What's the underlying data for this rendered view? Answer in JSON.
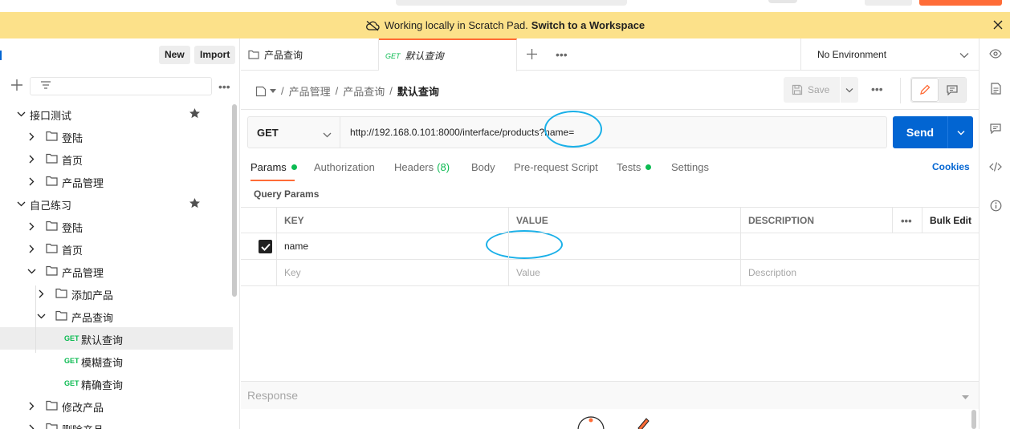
{
  "banner": {
    "text": "Working locally in Scratch Pad.",
    "link": "Switch to a Workspace"
  },
  "sidebar": {
    "new_label": "New",
    "import_label": "Import",
    "tree": [
      {
        "label": "接口测试",
        "type": "collection",
        "expanded": true,
        "starred": true
      },
      {
        "label": "登陆",
        "type": "folder",
        "expanded": false
      },
      {
        "label": "首页",
        "type": "folder",
        "expanded": false
      },
      {
        "label": "产品管理",
        "type": "folder",
        "expanded": false
      },
      {
        "label": "自己练习",
        "type": "collection",
        "expanded": true,
        "starred": true
      },
      {
        "label": "登陆",
        "type": "folder",
        "expanded": false
      },
      {
        "label": "首页",
        "type": "folder",
        "expanded": false
      },
      {
        "label": "产品管理",
        "type": "folder",
        "expanded": true
      },
      {
        "label": "添加产品",
        "type": "folder",
        "expanded": false
      },
      {
        "label": "产品查询",
        "type": "folder",
        "expanded": true
      },
      {
        "label": "默认查询",
        "type": "request",
        "method": "GET",
        "selected": true
      },
      {
        "label": "模糊查询",
        "type": "request",
        "method": "GET"
      },
      {
        "label": "精确查询",
        "type": "request",
        "method": "GET"
      },
      {
        "label": "修改产品",
        "type": "folder",
        "expanded": false
      },
      {
        "label": "删除产品",
        "type": "folder",
        "expanded": false
      }
    ]
  },
  "tabs": [
    {
      "label": "产品查询",
      "type": "folder"
    },
    {
      "label": "默认查询",
      "method": "GET",
      "active": true
    }
  ],
  "environment": "No Environment",
  "breadcrumb": {
    "items": [
      "产品管理",
      "产品查询"
    ],
    "current": "默认查询"
  },
  "toolbar": {
    "save_label": "Save"
  },
  "request": {
    "method": "GET",
    "url": "http://192.168.0.101:8000/interface/products?name=",
    "send_label": "Send"
  },
  "subtabs": [
    {
      "label": "Params",
      "active": true,
      "dot": true
    },
    {
      "label": "Authorization"
    },
    {
      "label": "Headers",
      "count": "(8)"
    },
    {
      "label": "Body"
    },
    {
      "label": "Pre-request Script"
    },
    {
      "label": "Tests",
      "dot": true
    },
    {
      "label": "Settings"
    }
  ],
  "cookies_label": "Cookies",
  "query_params": {
    "title": "Query Params",
    "columns": [
      "KEY",
      "VALUE",
      "DESCRIPTION"
    ],
    "bulk_edit": "Bulk Edit",
    "rows": [
      {
        "checked": true,
        "key": "name",
        "value": "",
        "description": ""
      }
    ],
    "placeholders": {
      "key": "Key",
      "value": "Value",
      "description": "Description"
    }
  },
  "response": {
    "title": "Response"
  },
  "colors": {
    "accent": "#ff6c37",
    "primary": "#0265d2",
    "get_method": "#0cbb52",
    "banner_bg": "#fce18a",
    "annotation": "#1ab0e8"
  }
}
